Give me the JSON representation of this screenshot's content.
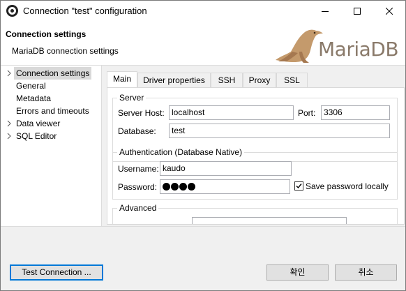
{
  "window": {
    "title": "Connection \"test\" configuration"
  },
  "header": {
    "title": "Connection settings",
    "subtitle": "MariaDB connection settings",
    "logo_text": "MariaDB"
  },
  "tree": {
    "items": [
      {
        "label": "Connection settings",
        "expandable": true,
        "selected": true
      },
      {
        "label": "General",
        "expandable": false
      },
      {
        "label": "Metadata",
        "expandable": false
      },
      {
        "label": "Errors and timeouts",
        "expandable": false
      },
      {
        "label": "Data viewer",
        "expandable": true
      },
      {
        "label": "SQL Editor",
        "expandable": true
      }
    ]
  },
  "tabs": [
    "Main",
    "Driver properties",
    "SSH",
    "Proxy",
    "SSL"
  ],
  "server": {
    "legend": "Server",
    "host_label": "Server Host:",
    "host_value": "localhost",
    "port_label": "Port:",
    "port_value": "3306",
    "database_label": "Database:",
    "database_value": "test"
  },
  "auth": {
    "legend": "Authentication (Database Native)",
    "username_label": "Username:",
    "username_value": "kaudo",
    "password_label": "Password:",
    "password_length": 4,
    "save_password_label": "Save password locally",
    "save_password_checked": true
  },
  "advanced": {
    "legend": "Advanced"
  },
  "buttons": {
    "test_connection": "Test Connection ...",
    "ok": "확인",
    "cancel": "취소"
  }
}
